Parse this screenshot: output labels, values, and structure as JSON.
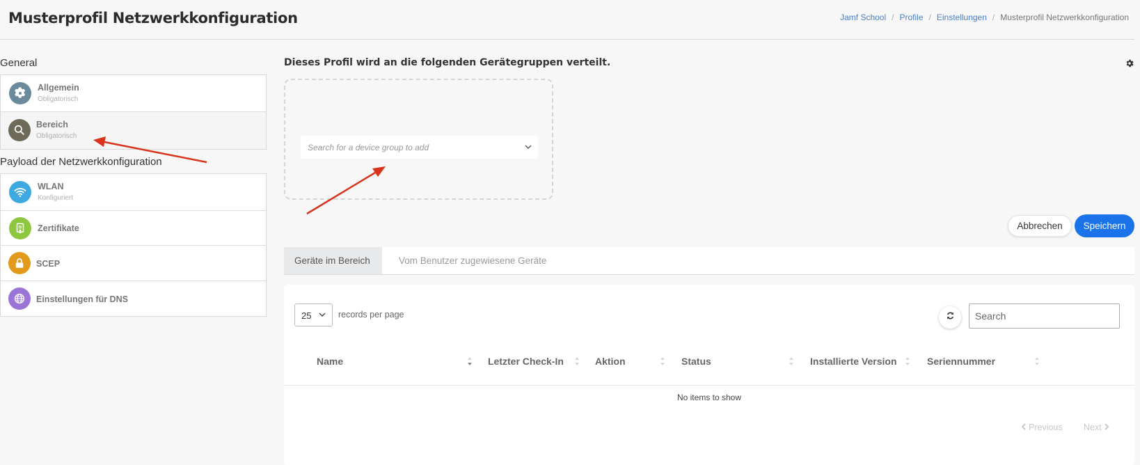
{
  "header": {
    "title": "Musterprofil Netzwerkkonfiguration",
    "breadcrumb": [
      "Jamf School",
      "Profile",
      "Einstellungen",
      "Musterprofil Netzwerkkonfiguration"
    ]
  },
  "sidebar": {
    "general_label": "General",
    "general_items": [
      {
        "label": "Allgemein",
        "sub": "Obligatorisch",
        "icon": "gear-icon"
      },
      {
        "label": "Bereich",
        "sub": "Obligatorisch",
        "icon": "magnifier-icon"
      }
    ],
    "payload_label": "Payload der Netzwerkkonfiguration",
    "payload_items": [
      {
        "label": "WLAN",
        "sub": "Konfiguriert",
        "icon": "wifi-icon"
      },
      {
        "label": "Zertifikate",
        "icon": "certificate-icon"
      },
      {
        "label": "SCEP",
        "icon": "lock-icon"
      },
      {
        "label": "Einstellungen für DNS",
        "icon": "globe-icon"
      }
    ]
  },
  "scope": {
    "title": "Dieses Profil wird an die folgenden Gerätegruppen verteilt.",
    "search_placeholder": "Search for a device group to add"
  },
  "actions": {
    "cancel": "Abbrechen",
    "save": "Speichern"
  },
  "tabs": [
    "Geräte im Bereich",
    "Vom Benutzer zugewiesene Geräte"
  ],
  "table": {
    "per_page_value": "25",
    "records_label": "records per page",
    "search_placeholder": "Search",
    "columns": [
      "Name",
      "Letzter Check-In",
      "Aktion",
      "Status",
      "Installierte Version",
      "Seriennummer"
    ],
    "empty_message": "No items to show",
    "prev": "Previous",
    "next": "Next"
  },
  "colors": {
    "primary": "#1a73e8",
    "link": "#4a7fc9",
    "annotation_arrow": "#d9331c"
  }
}
